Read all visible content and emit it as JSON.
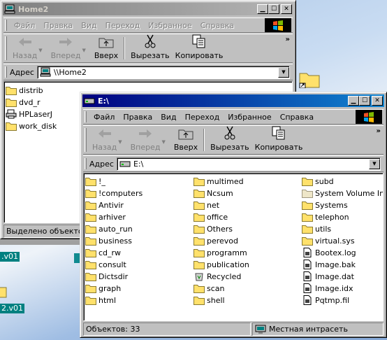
{
  "desktop": {
    "labels": [
      ".v01",
      ".v01",
      "2.v01"
    ]
  },
  "window_back": {
    "title": "Home2",
    "menu": [
      "Файл",
      "Правка",
      "Вид",
      "Переход",
      "Избранное",
      "Справка"
    ],
    "toolbar": {
      "back": "Назад",
      "forward": "Вперед",
      "up": "Вверх",
      "cut": "Вырезать",
      "copy": "Копировать",
      "more": "»"
    },
    "address_label": "Адрес",
    "address_value": "\\\\Home2",
    "items": [
      {
        "name": "distrib",
        "icon": "folder-icon"
      },
      {
        "name": "dvd_r",
        "icon": "folder-icon"
      },
      {
        "name": "HPLaserJ",
        "icon": "printer-icon"
      },
      {
        "name": "work_disk",
        "icon": "folder-icon"
      }
    ],
    "status": "Выделено объектов: "
  },
  "window_front": {
    "title": "E:\\",
    "menu": [
      "Файл",
      "Правка",
      "Вид",
      "Переход",
      "Избранное",
      "Справка"
    ],
    "toolbar": {
      "back": "Назад",
      "forward": "Вперед",
      "up": "Вверх",
      "cut": "Вырезать",
      "copy": "Копировать",
      "more": "»"
    },
    "address_label": "Адрес",
    "address_value": "E:\\",
    "columns": [
      [
        {
          "name": "!_",
          "icon": "folder-icon"
        },
        {
          "name": "!computers",
          "icon": "folder-icon"
        },
        {
          "name": "Antivir",
          "icon": "folder-icon"
        },
        {
          "name": "arhiver",
          "icon": "folder-icon"
        },
        {
          "name": "auto_run",
          "icon": "folder-icon"
        },
        {
          "name": "business",
          "icon": "folder-icon"
        },
        {
          "name": "cd_rw",
          "icon": "folder-icon"
        },
        {
          "name": "consult",
          "icon": "folder-icon"
        },
        {
          "name": "Dictsdir",
          "icon": "folder-icon"
        },
        {
          "name": "graph",
          "icon": "folder-icon"
        },
        {
          "name": "html",
          "icon": "folder-icon"
        }
      ],
      [
        {
          "name": "multimed",
          "icon": "folder-icon"
        },
        {
          "name": "Ncsum",
          "icon": "folder-icon"
        },
        {
          "name": "net",
          "icon": "folder-icon"
        },
        {
          "name": "office",
          "icon": "folder-icon"
        },
        {
          "name": "Others",
          "icon": "folder-icon"
        },
        {
          "name": "perevod",
          "icon": "folder-icon"
        },
        {
          "name": "programm",
          "icon": "folder-icon"
        },
        {
          "name": "publication",
          "icon": "folder-icon"
        },
        {
          "name": "Recycled",
          "icon": "recycle-bin-icon"
        },
        {
          "name": "scan",
          "icon": "folder-icon"
        },
        {
          "name": "shell",
          "icon": "folder-icon"
        }
      ],
      [
        {
          "name": "subd",
          "icon": "folder-icon"
        },
        {
          "name": "System Volume Inform",
          "icon": "system-folder-icon"
        },
        {
          "name": "Systems",
          "icon": "folder-icon"
        },
        {
          "name": "telephon",
          "icon": "folder-icon"
        },
        {
          "name": "utils",
          "icon": "folder-icon"
        },
        {
          "name": "virtual.sys",
          "icon": "folder-icon"
        },
        {
          "name": "Bootex.log",
          "icon": "document-icon"
        },
        {
          "name": "Image.bak",
          "icon": "document-icon"
        },
        {
          "name": "Image.dat",
          "icon": "document-icon"
        },
        {
          "name": "Image.idx",
          "icon": "document-icon"
        },
        {
          "name": "Pqtmp.fil",
          "icon": "document-icon"
        }
      ]
    ],
    "status_count": "Объектов: 33",
    "status_zone": "Местная интрасеть"
  },
  "colors": {
    "active_title": "#000080",
    "inactive_title": "#808080",
    "chrome": "#c0c0c0",
    "folder": "#ffe16b",
    "desktop_label": "#008080"
  }
}
